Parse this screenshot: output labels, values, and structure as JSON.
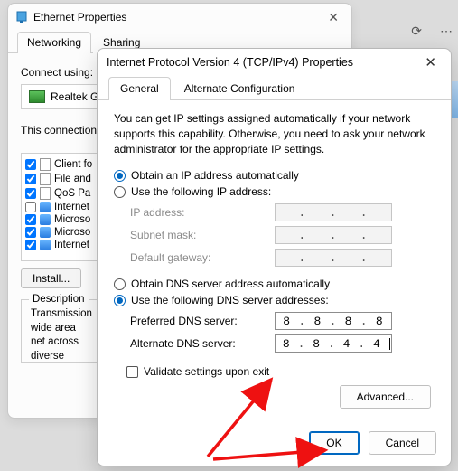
{
  "bg": {
    "title": "Ethernet Properties",
    "tabs": [
      "Networking",
      "Sharing"
    ],
    "connect_using": "Connect using:",
    "adapter": "Realtek G",
    "conn_label": "This connection",
    "items": [
      {
        "checked": true,
        "icon": "file",
        "label": "Client fo"
      },
      {
        "checked": true,
        "icon": "file",
        "label": "File and"
      },
      {
        "checked": true,
        "icon": "file",
        "label": "QoS Pa"
      },
      {
        "checked": false,
        "icon": "net",
        "label": "Internet"
      },
      {
        "checked": true,
        "icon": "net",
        "label": "Microso"
      },
      {
        "checked": true,
        "icon": "net",
        "label": "Microso"
      },
      {
        "checked": true,
        "icon": "net",
        "label": "Internet"
      }
    ],
    "install_btn": "Install...",
    "desc_title": "Description",
    "desc_text": "Transmission wide area net across diverse"
  },
  "fg": {
    "title": "Internet Protocol Version 4 (TCP/IPv4) Properties",
    "tabs": [
      "General",
      "Alternate Configuration"
    ],
    "intro": "You can get IP settings assigned automatically if your network supports this capability. Otherwise, you need to ask your network administrator for the appropriate IP settings.",
    "ip_auto": "Obtain an IP address automatically",
    "ip_manual": "Use the following IP address:",
    "ip_label": "IP address:",
    "subnet_label": "Subnet mask:",
    "gateway_label": "Default gateway:",
    "dns_auto": "Obtain DNS server address automatically",
    "dns_manual": "Use the following DNS server addresses:",
    "pref_dns_label": "Preferred DNS server:",
    "alt_dns_label": "Alternate DNS server:",
    "pref_dns": [
      "8",
      "8",
      "8",
      "8"
    ],
    "alt_dns": [
      "8",
      "8",
      "4",
      "4"
    ],
    "validate": "Validate settings upon exit",
    "advanced": "Advanced...",
    "ok": "OK",
    "cancel": "Cancel"
  }
}
